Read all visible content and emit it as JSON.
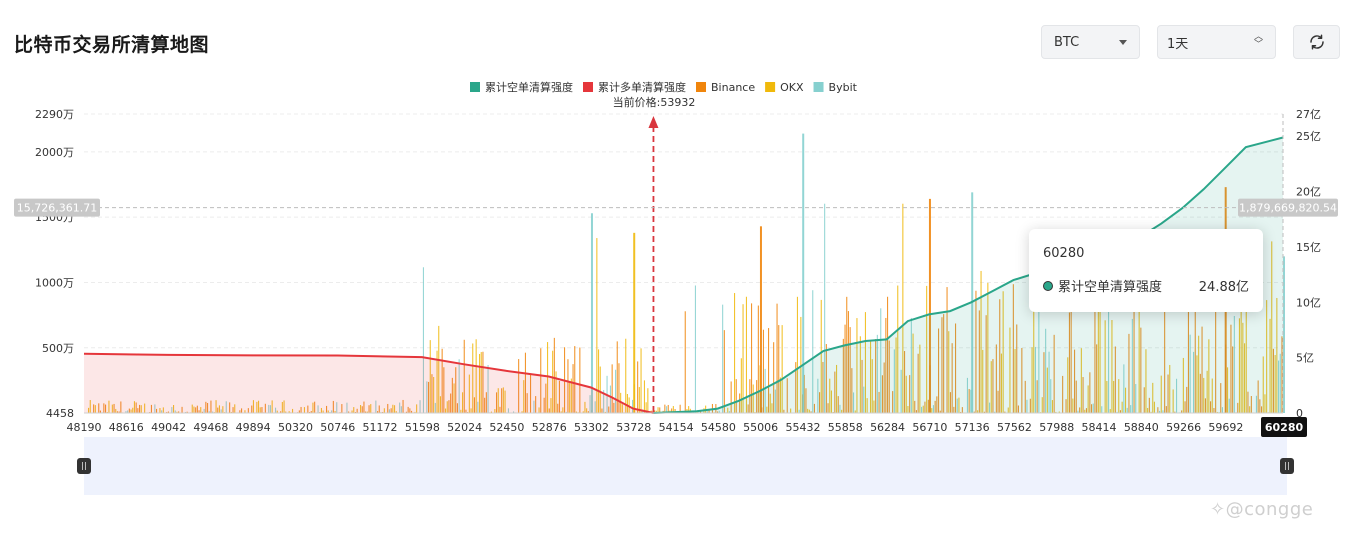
{
  "page": {
    "title": "比特币交易所清算地图",
    "watermark": "✧@congge"
  },
  "controls": {
    "coin": "BTC",
    "period": "1天",
    "refresh_icon": "refresh-icon"
  },
  "tooltip": {
    "x": "60280",
    "series": "累计空单清算强度",
    "value": "24.88亿"
  },
  "chart_data": {
    "type": "bar",
    "legend_position": "top-center",
    "legend": [
      {
        "name": "累计空单清算强度",
        "color": "#2aa68a"
      },
      {
        "name": "累计多单清算强度",
        "color": "#e5363b"
      },
      {
        "name": "Binance",
        "color": "#f0850c"
      },
      {
        "name": "OKX",
        "color": "#f0b90b"
      },
      {
        "name": "Bybit",
        "color": "#86d0cf"
      }
    ],
    "current_price_label": "当前价格:53932",
    "current_price": 53932,
    "x_range": [
      48190,
      60280
    ],
    "x_ticks": [
      "48190",
      "48616",
      "49042",
      "49468",
      "49894",
      "50320",
      "50746",
      "51172",
      "51598",
      "52024",
      "52450",
      "52876",
      "53302",
      "53728",
      "54154",
      "54580",
      "55006",
      "55432",
      "55858",
      "56284",
      "56710",
      "57136",
      "57562",
      "57988",
      "58414",
      "58840",
      "59266",
      "59692",
      "60280"
    ],
    "y_left": {
      "range": [
        4458,
        22900000
      ],
      "ticks": [
        {
          "label": "2290万",
          "value": 22900000
        },
        {
          "label": "2000万",
          "value": 20000000
        },
        {
          "label": "1500万",
          "value": 15000000
        },
        {
          "label": "1000万",
          "value": 10000000
        },
        {
          "label": "500万",
          "value": 5000000
        },
        {
          "label": "4458",
          "value": 4458
        }
      ]
    },
    "y_right": {
      "range": [
        0,
        2700000000
      ],
      "ticks": [
        {
          "label": "27亿",
          "value": 2700000000
        },
        {
          "label": "25亿",
          "value": 2500000000
        },
        {
          "label": "20亿",
          "value": 2000000000
        },
        {
          "label": "15亿",
          "value": 1500000000
        },
        {
          "label": "10亿",
          "value": 1000000000
        },
        {
          "label": "5亿",
          "value": 500000000
        },
        {
          "label": "0",
          "value": 0
        }
      ]
    },
    "crosshair": {
      "left_label": "15,726,361.71",
      "left_value": 15726361.71,
      "right_label": "1,879,669,820.54",
      "x_label": "60280"
    },
    "long_cumulative": {
      "x": [
        48190,
        49042,
        49894,
        50746,
        51598,
        52024,
        52450,
        52876,
        53302,
        53515,
        53728,
        53932
      ],
      "y": [
        535000000,
        525000000,
        520000000,
        519000000,
        505000000,
        440000000,
        380000000,
        330000000,
        230000000,
        140000000,
        40000000,
        0
      ]
    },
    "short_cumulative": {
      "x": [
        53932,
        54367,
        54580,
        54793,
        55006,
        55219,
        55432,
        55645,
        55858,
        56071,
        56284,
        56497,
        56710,
        56923,
        57136,
        57349,
        57562,
        57775,
        57988,
        58201,
        58414,
        58627,
        58840,
        59053,
        59266,
        59479,
        59692,
        59905,
        60280
      ],
      "y": [
        0,
        15000000,
        40000000,
        110000000,
        200000000,
        300000000,
        430000000,
        560000000,
        610000000,
        650000000,
        665000000,
        830000000,
        890000000,
        920000000,
        1000000000,
        1100000000,
        1200000000,
        1260000000,
        1290000000,
        1320000000,
        1360000000,
        1440000000,
        1590000000,
        1710000000,
        1850000000,
        2020000000,
        2210000000,
        2400000000,
        2488000000
      ]
    },
    "exchange_bars_note": "dense per-price liquidation bars (Binance / OKX / Bybit) between 48190 and 60280",
    "bar_peaks": [
      {
        "x": 53302,
        "value": 15300000,
        "exchange": "Bybit"
      },
      {
        "x": 53728,
        "value": 13800000,
        "exchange": "OKX"
      },
      {
        "x": 55006,
        "value": 14300000,
        "exchange": "Binance"
      },
      {
        "x": 55432,
        "value": 21400000,
        "exchange": "Bybit"
      },
      {
        "x": 56710,
        "value": 16400000,
        "exchange": "Binance"
      },
      {
        "x": 57136,
        "value": 16900000,
        "exchange": "Bybit"
      },
      {
        "x": 59692,
        "value": 17300000,
        "exchange": "Binance"
      },
      {
        "x": 60280,
        "value": 12000000,
        "exchange": "Bybit"
      }
    ]
  }
}
